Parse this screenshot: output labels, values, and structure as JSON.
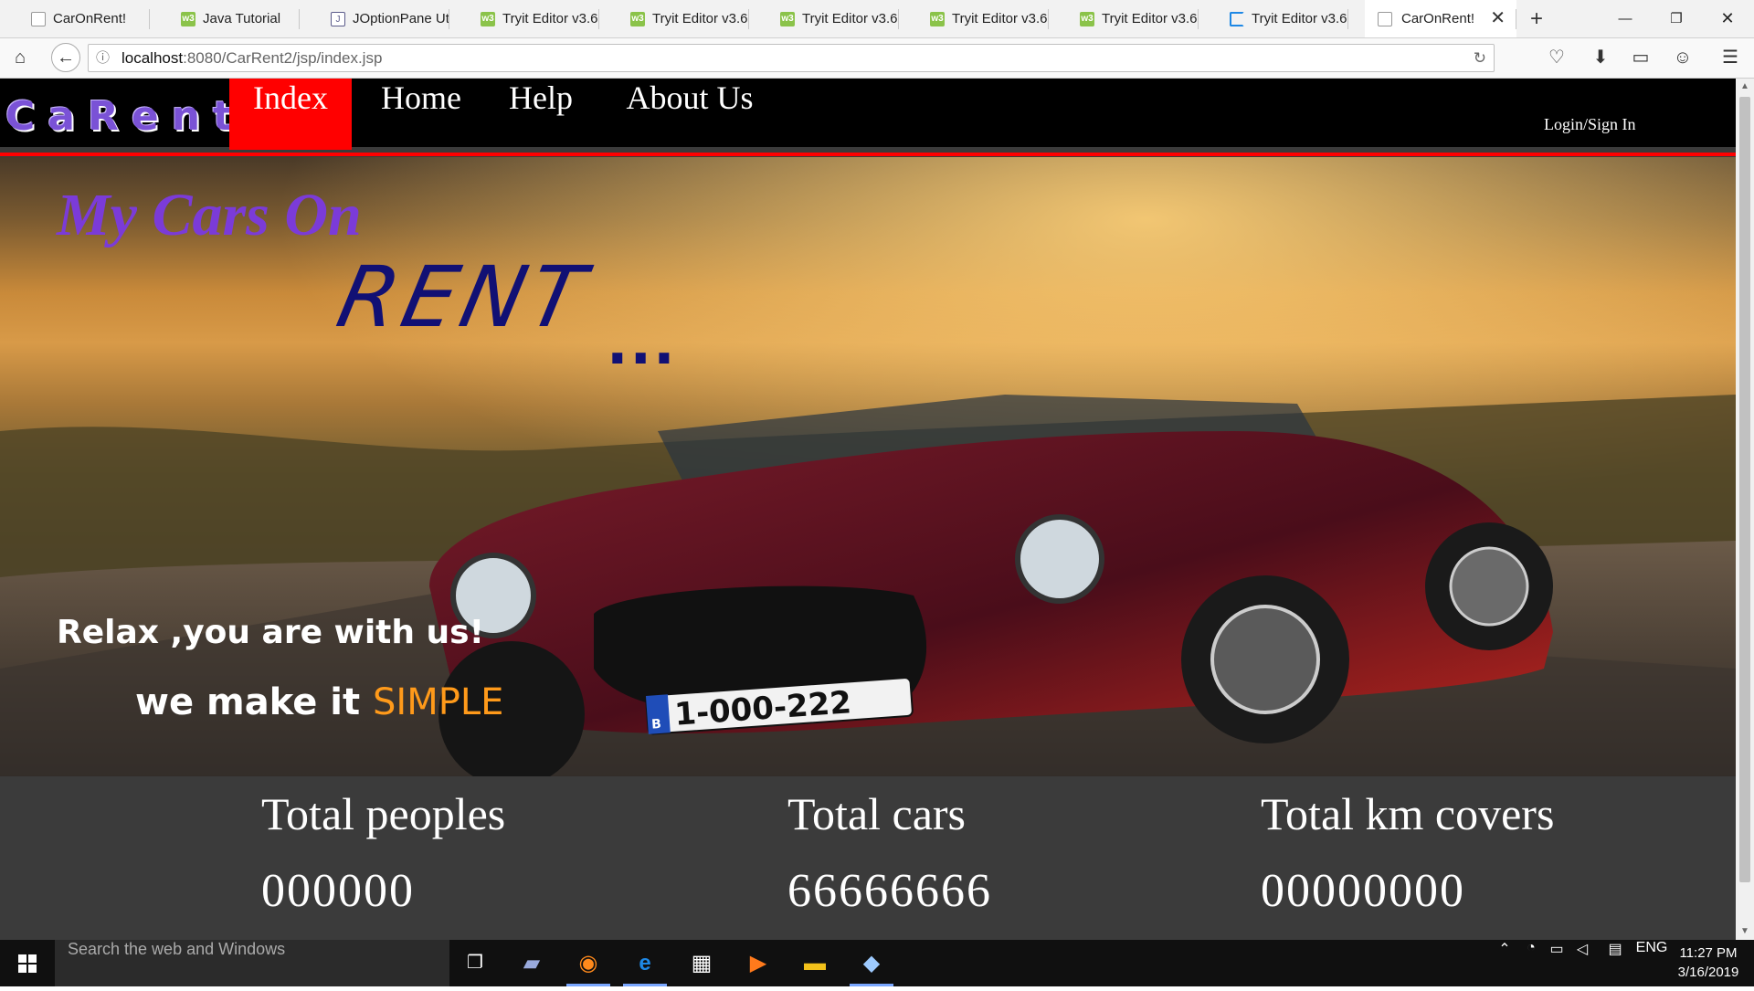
{
  "browser": {
    "tabs": [
      {
        "title": "CarOnRent!",
        "icon": "page-icon"
      },
      {
        "title": "Java Tutorial",
        "icon": "w3-icon"
      },
      {
        "title": "JOptionPane Ut...",
        "icon": "javadoc-icon"
      },
      {
        "title": "Tryit Editor v3.6",
        "icon": "w3-icon"
      },
      {
        "title": "Tryit Editor v3.6",
        "icon": "w3-icon"
      },
      {
        "title": "Tryit Editor v3.6",
        "icon": "w3-icon"
      },
      {
        "title": "Tryit Editor v3.6",
        "icon": "w3-icon"
      },
      {
        "title": "Tryit Editor v3.6",
        "icon": "w3-icon"
      },
      {
        "title": "Tryit Editor v3.6",
        "icon": "loading-icon"
      },
      {
        "title": "CarOnRent!",
        "icon": "page-icon",
        "active": true
      }
    ],
    "url_host": "localhost",
    "url_rest": ":8080/CarRent2/jsp/index.jsp"
  },
  "site": {
    "brand": "CaRent",
    "nav": [
      "Index",
      "Home",
      "Help",
      "About Us"
    ],
    "active_nav": "Index",
    "login": "Login/Sign In",
    "accent_color": "#ff0000"
  },
  "hero": {
    "line1": "My Cars On",
    "line2": "RENT",
    "dots": "...",
    "relax": "Relax ,you are with us!",
    "simple_prefix": "we make it ",
    "simple_word": "SIMPLE",
    "plate": "1-000-222",
    "plate_country": "B"
  },
  "stats": [
    {
      "label": "Total peoples",
      "value": "000000"
    },
    {
      "label": "Total cars",
      "value": "66666666"
    },
    {
      "label": "Total km covers",
      "value": "00000000"
    }
  ],
  "taskbar": {
    "search_placeholder": "Search the web and Windows",
    "language": "ENG",
    "time": "11:27 PM",
    "date": "3/16/2019"
  }
}
